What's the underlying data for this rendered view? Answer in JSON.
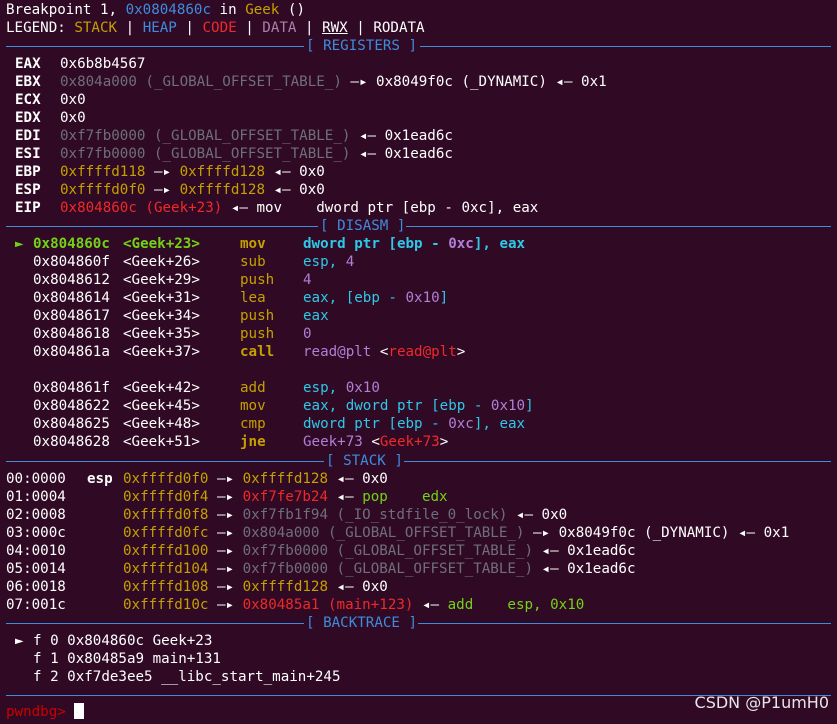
{
  "header": {
    "bp_prefix": "Breakpoint 1, ",
    "bp_addr": "0x0804860c",
    "bp_in": " in ",
    "bp_func": "Geek",
    "bp_suffix": " ()",
    "legend_label": "LEGEND: ",
    "legend_stack": "STACK",
    "legend_heap": "HEAP",
    "legend_code": "CODE",
    "legend_data": "DATA",
    "legend_rwx": "RWX",
    "legend_rodata": "RODATA",
    "pipe": " | "
  },
  "sections": {
    "registers": "[ REGISTERS ]",
    "disasm": "[ DISASM ]",
    "stack": "[ STACK ]",
    "backtrace": "[ BACKTRACE ]"
  },
  "registers": [
    {
      "name": "EAX",
      "parts": [
        {
          "t": "0x6b8b4567",
          "c": "c-white"
        }
      ]
    },
    {
      "name": "EBX",
      "parts": [
        {
          "t": "0x804a000 (_GLOBAL_OFFSET_TABLE_)",
          "c": "c-gray"
        },
        {
          "t": " —▸ 0x8049f0c (_DYNAMIC) ◂— 0x1",
          "c": "c-white"
        }
      ]
    },
    {
      "name": "ECX",
      "parts": [
        {
          "t": "0x0",
          "c": "c-white"
        }
      ]
    },
    {
      "name": "EDX",
      "parts": [
        {
          "t": "0x0",
          "c": "c-white"
        }
      ]
    },
    {
      "name": "EDI",
      "parts": [
        {
          "t": "0xf7fb0000 (_GLOBAL_OFFSET_TABLE_)",
          "c": "c-gray"
        },
        {
          "t": " ◂— 0x1ead6c",
          "c": "c-white"
        }
      ]
    },
    {
      "name": "ESI",
      "parts": [
        {
          "t": "0xf7fb0000 (_GLOBAL_OFFSET_TABLE_)",
          "c": "c-gray"
        },
        {
          "t": " ◂— 0x1ead6c",
          "c": "c-white"
        }
      ]
    },
    {
      "name": "EBP",
      "parts": [
        {
          "t": "0xffffd118",
          "c": "c-yellow"
        },
        {
          "t": " —▸ ",
          "c": "c-white"
        },
        {
          "t": "0xffffd128",
          "c": "c-yellow"
        },
        {
          "t": " ◂— 0x0",
          "c": "c-white"
        }
      ]
    },
    {
      "name": "ESP",
      "parts": [
        {
          "t": "0xffffd0f0",
          "c": "c-yellow"
        },
        {
          "t": " —▸ ",
          "c": "c-white"
        },
        {
          "t": "0xffffd128",
          "c": "c-yellow"
        },
        {
          "t": " ◂— 0x0",
          "c": "c-white"
        }
      ]
    },
    {
      "name": "EIP",
      "parts": [
        {
          "t": "0x804860c (Geek+23)",
          "c": "c-red"
        },
        {
          "t": " ◂— mov    dword ptr [ebp - 0xc], eax",
          "c": "c-white"
        }
      ]
    }
  ],
  "disasm": [
    {
      "marker": "►",
      "addr": "0x804860c",
      "sym": "<Geek+23>",
      "op": "mov",
      "args": [
        {
          "t": "dword ptr [ebp - ",
          "c": "c-cyanb bold"
        },
        {
          "t": "0xc",
          "c": "c-violet bold"
        },
        {
          "t": "], eax",
          "c": "c-cyanb bold"
        }
      ],
      "current": true
    },
    {
      "marker": "",
      "addr": "0x804860f",
      "sym": "<Geek+26>",
      "op": "sub",
      "args": [
        {
          "t": "esp, ",
          "c": "c-cyanb"
        },
        {
          "t": "4",
          "c": "c-violet"
        }
      ]
    },
    {
      "marker": "",
      "addr": "0x8048612",
      "sym": "<Geek+29>",
      "op": "push",
      "args": [
        {
          "t": "4",
          "c": "c-violet"
        }
      ]
    },
    {
      "marker": "",
      "addr": "0x8048614",
      "sym": "<Geek+31>",
      "op": "lea",
      "args": [
        {
          "t": "eax, [ebp - ",
          "c": "c-cyanb"
        },
        {
          "t": "0x10",
          "c": "c-violet"
        },
        {
          "t": "]",
          "c": "c-cyanb"
        }
      ]
    },
    {
      "marker": "",
      "addr": "0x8048617",
      "sym": "<Geek+34>",
      "op": "push",
      "args": [
        {
          "t": "eax",
          "c": "c-cyanb"
        }
      ]
    },
    {
      "marker": "",
      "addr": "0x8048618",
      "sym": "<Geek+35>",
      "op": "push",
      "args": [
        {
          "t": "0",
          "c": "c-violet"
        }
      ]
    },
    {
      "marker": "",
      "addr": "0x804861a",
      "sym": "<Geek+37>",
      "op": "call",
      "opbold": true,
      "args": [
        {
          "t": "read@plt ",
          "c": "c-violet"
        },
        {
          "t": "<",
          "c": "c-white"
        },
        {
          "t": "read@plt",
          "c": "c-red"
        },
        {
          "t": ">",
          "c": "c-white"
        }
      ]
    },
    {
      "marker": "",
      "addr": "0x804861f",
      "sym": "<Geek+42>",
      "op": "add",
      "args": [
        {
          "t": "esp, ",
          "c": "c-cyanb"
        },
        {
          "t": "0x10",
          "c": "c-violet"
        }
      ],
      "gap": true
    },
    {
      "marker": "",
      "addr": "0x8048622",
      "sym": "<Geek+45>",
      "op": "mov",
      "args": [
        {
          "t": "eax, dword ptr [ebp - ",
          "c": "c-cyanb"
        },
        {
          "t": "0x10",
          "c": "c-violet"
        },
        {
          "t": "]",
          "c": "c-cyanb"
        }
      ]
    },
    {
      "marker": "",
      "addr": "0x8048625",
      "sym": "<Geek+48>",
      "op": "cmp",
      "args": [
        {
          "t": "dword ptr [ebp - ",
          "c": "c-cyanb"
        },
        {
          "t": "0xc",
          "c": "c-violet"
        },
        {
          "t": "], eax",
          "c": "c-cyanb"
        }
      ]
    },
    {
      "marker": "",
      "addr": "0x8048628",
      "sym": "<Geek+51>",
      "op": "jne",
      "opbold": true,
      "args": [
        {
          "t": "Geek+73 ",
          "c": "c-violet"
        },
        {
          "t": "<",
          "c": "c-white"
        },
        {
          "t": "Geek+73",
          "c": "c-red"
        },
        {
          "t": ">",
          "c": "c-white"
        }
      ]
    }
  ],
  "stack": [
    {
      "idx": "00:0000",
      "reg": "esp",
      "parts": [
        {
          "t": "0xffffd0f0",
          "c": "c-yellow"
        },
        {
          "t": " —▸ ",
          "c": "c-white"
        },
        {
          "t": "0xffffd128",
          "c": "c-yellow"
        },
        {
          "t": " ◂— 0x0",
          "c": "c-white"
        }
      ]
    },
    {
      "idx": "01:0004",
      "reg": "",
      "parts": [
        {
          "t": "0xffffd0f4",
          "c": "c-yellow"
        },
        {
          "t": " —▸ ",
          "c": "c-white"
        },
        {
          "t": "0xf7fe7b24",
          "c": "c-red"
        },
        {
          "t": " ◂— ",
          "c": "c-white"
        },
        {
          "t": "pop    edx",
          "c": "c-green"
        }
      ]
    },
    {
      "idx": "02:0008",
      "reg": "",
      "parts": [
        {
          "t": "0xffffd0f8",
          "c": "c-yellow"
        },
        {
          "t": " —▸ ",
          "c": "c-white"
        },
        {
          "t": "0xf7fb1f94 (_IO_stdfile_0_lock)",
          "c": "c-gray"
        },
        {
          "t": " ◂— 0x0",
          "c": "c-white"
        }
      ]
    },
    {
      "idx": "03:000c",
      "reg": "",
      "parts": [
        {
          "t": "0xffffd0fc",
          "c": "c-yellow"
        },
        {
          "t": " —▸ ",
          "c": "c-white"
        },
        {
          "t": "0x804a000 (_GLOBAL_OFFSET_TABLE_)",
          "c": "c-gray"
        },
        {
          "t": " —▸ 0x8049f0c (_DYNAMIC) ◂— 0x1",
          "c": "c-white"
        }
      ]
    },
    {
      "idx": "04:0010",
      "reg": "",
      "parts": [
        {
          "t": "0xffffd100",
          "c": "c-yellow"
        },
        {
          "t": " —▸ ",
          "c": "c-white"
        },
        {
          "t": "0xf7fb0000 (_GLOBAL_OFFSET_TABLE_)",
          "c": "c-gray"
        },
        {
          "t": " ◂— 0x1ead6c",
          "c": "c-white"
        }
      ]
    },
    {
      "idx": "05:0014",
      "reg": "",
      "parts": [
        {
          "t": "0xffffd104",
          "c": "c-yellow"
        },
        {
          "t": " —▸ ",
          "c": "c-white"
        },
        {
          "t": "0xf7fb0000 (_GLOBAL_OFFSET_TABLE_)",
          "c": "c-gray"
        },
        {
          "t": " ◂— 0x1ead6c",
          "c": "c-white"
        }
      ]
    },
    {
      "idx": "06:0018",
      "reg": "",
      "parts": [
        {
          "t": "0xffffd108",
          "c": "c-yellow"
        },
        {
          "t": " —▸ ",
          "c": "c-white"
        },
        {
          "t": "0xffffd128",
          "c": "c-yellow"
        },
        {
          "t": " ◂— 0x0",
          "c": "c-white"
        }
      ]
    },
    {
      "idx": "07:001c",
      "reg": "",
      "parts": [
        {
          "t": "0xffffd10c",
          "c": "c-yellow"
        },
        {
          "t": " —▸ ",
          "c": "c-white"
        },
        {
          "t": "0x80485a1 (main+123)",
          "c": "c-red"
        },
        {
          "t": " ◂— ",
          "c": "c-white"
        },
        {
          "t": "add    esp, 0x10",
          "c": "c-green"
        }
      ]
    }
  ],
  "backtrace": [
    {
      "marker": "►",
      "text": "f 0 0x804860c Geek+23"
    },
    {
      "marker": "",
      "text": "f 1 0x80485a9 main+131"
    },
    {
      "marker": "",
      "text": "f 2 0xf7de3ee5 __libc_start_main+245"
    }
  ],
  "prompt": "pwndbg> ",
  "watermark": "CSDN @P1umH0",
  "colors": {
    "background": "#300a24",
    "separator": "#3f8cdd",
    "stack": "#c4a000",
    "code": "#ef2929",
    "data": "#ad7fa8"
  }
}
